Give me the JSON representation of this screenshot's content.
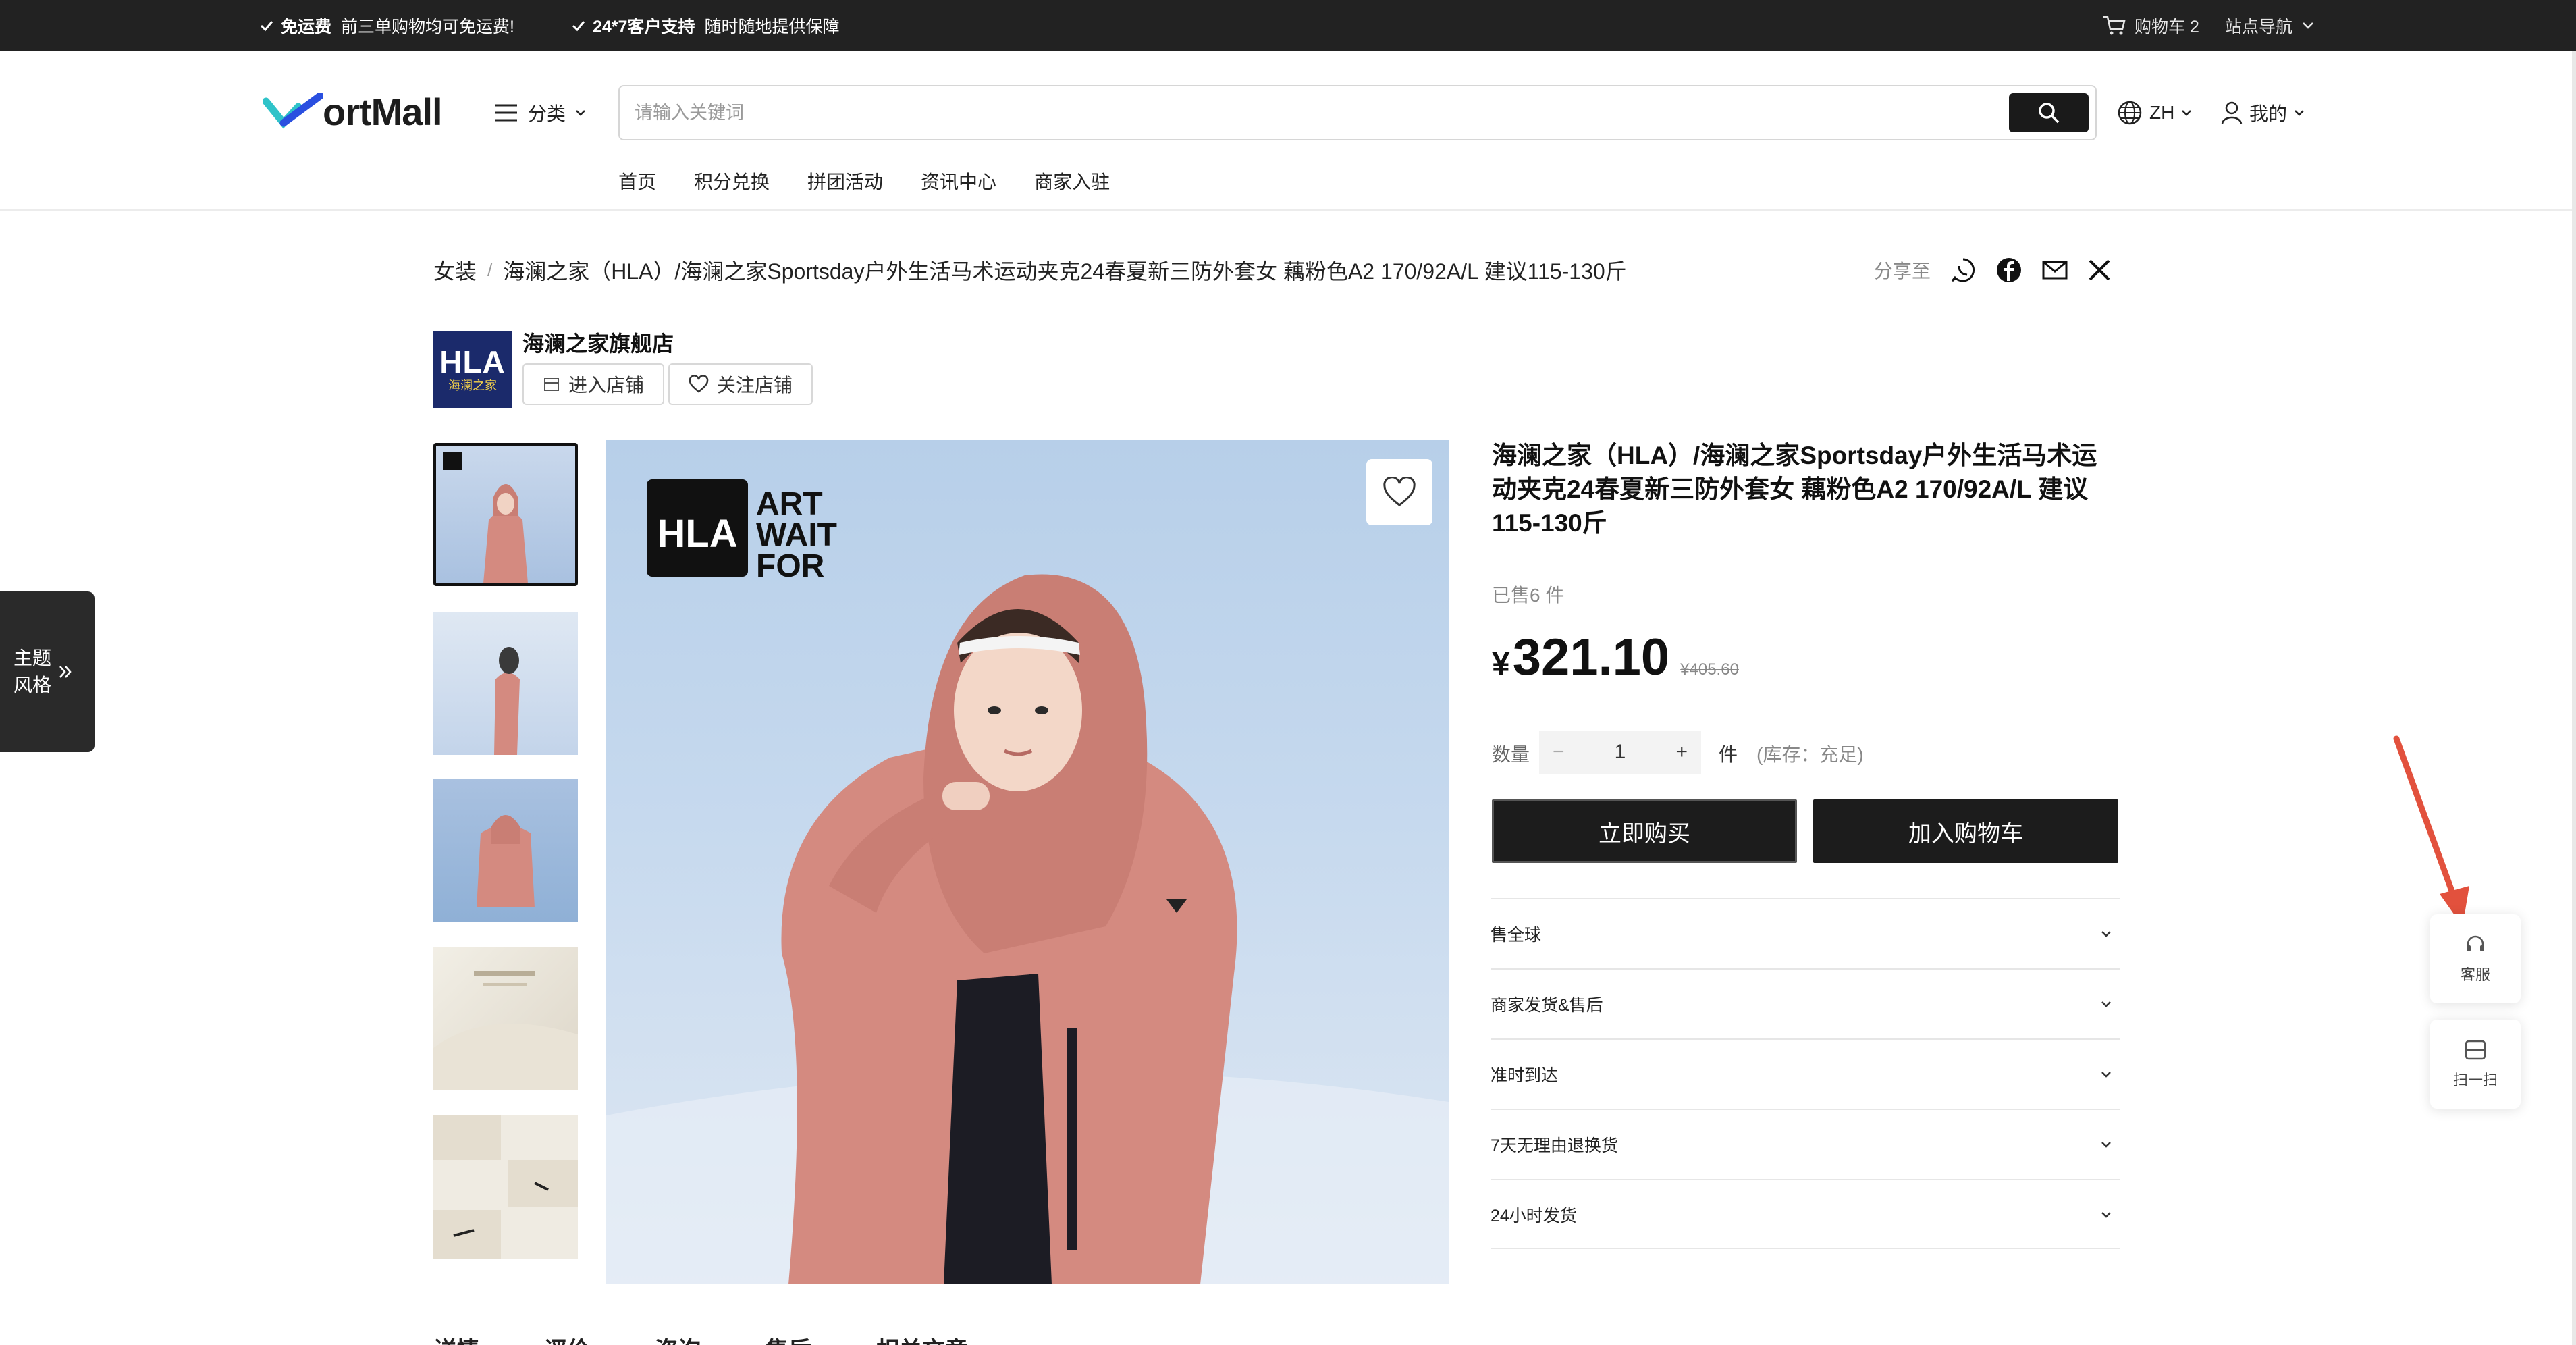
{
  "topbar": {
    "promo1_bold": "免运费",
    "promo1_text": "前三单购物均可免运费!",
    "promo2_bold": "24*7客户支持",
    "promo2_text": "随时随地提供保障",
    "cart_label": "购物车 2",
    "site_nav": "站点导航"
  },
  "header": {
    "logo_text": "ortMall",
    "category_label": "分类",
    "search_placeholder": "请输入关键词",
    "lang": "ZH",
    "mine": "我的",
    "nav": [
      "首页",
      "积分兑换",
      "拼团活动",
      "资讯中心",
      "商家入驻"
    ]
  },
  "breadcrumb": {
    "category": "女装",
    "product": "海澜之家（HLA）/海澜之家Sportsday户外生活马术运动夹克24春夏新三防外套女 藕粉色A2 170/92A/L 建议115-130斤",
    "share_label": "分享至"
  },
  "store": {
    "logo_big": "HLA",
    "logo_small": "海澜之家",
    "name": "海澜之家旗舰店",
    "enter_label": "进入店铺",
    "follow_label": "关注店铺"
  },
  "main_image": {
    "brand": "HLA",
    "slogan": [
      "ART",
      "WAIT",
      "FOR"
    ]
  },
  "product": {
    "title": "海澜之家（HLA）/海澜之家Sportsday户外生活马术运动夹克24春夏新三防外套女 藕粉色A2 170/92A/L 建议115-130斤",
    "sold": "已售6 件",
    "currency": "¥",
    "price": "321.10",
    "original_price": "¥405.60",
    "qty_label": "数量",
    "qty_minus": "−",
    "qty_value": "1",
    "qty_plus": "+",
    "unit": "件",
    "stock": "(库存：充足)",
    "buy_now": "立即购买",
    "add_cart": "加入购物车",
    "accordion": [
      "售全球",
      "商家发货&售后",
      "准时到达",
      "7天无理由退换货",
      "24小时发货"
    ]
  },
  "tabs": [
    "详情",
    "评价",
    "咨询",
    "售后",
    "相关文章"
  ],
  "theme_panel": {
    "line1": "主题",
    "line2": "风格"
  },
  "float_tools": {
    "service": "客服",
    "scan": "扫一扫"
  },
  "colors": {
    "topbar": "#222222",
    "button": "#1c1c1c",
    "arrow": "#e2513d",
    "jacket": "#d48a80"
  }
}
